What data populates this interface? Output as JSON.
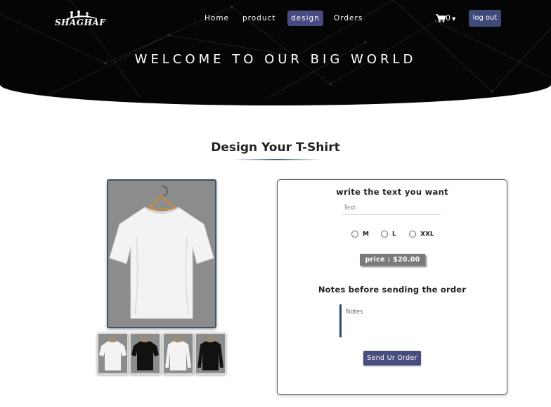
{
  "header": {
    "logo_text": "SHAGHAF",
    "nav": [
      {
        "label": "Home",
        "active": false
      },
      {
        "label": "product",
        "active": false
      },
      {
        "label": "design",
        "active": true
      },
      {
        "label": "Orders",
        "active": false
      }
    ],
    "cart_count": "0",
    "logout_label": "log out",
    "welcome": "WELCOME TO OUR BIG WORLD"
  },
  "design": {
    "title": "Design Your T-Shirt",
    "thumbnails": [
      {
        "name": "white-tshirt",
        "color": "#f2f2f2"
      },
      {
        "name": "black-tshirt",
        "color": "#151515"
      },
      {
        "name": "white-longsleeve",
        "color": "#f2f2f2"
      },
      {
        "name": "black-longsleeve",
        "color": "#151515"
      }
    ]
  },
  "form": {
    "text_label": "write the text you want",
    "text_placeholder": "Text",
    "sizes": [
      "M",
      "L",
      "XXL"
    ],
    "price": "price : $20.00",
    "notes_label": "Notes before sending the order",
    "notes_placeholder": "Notes",
    "send_label": "Send Ur Order"
  },
  "colors": {
    "header_bg": "#050505",
    "active_nav": "#4a4a82",
    "accent": "#474d7d",
    "preview_bg": "#8b8d8c"
  }
}
